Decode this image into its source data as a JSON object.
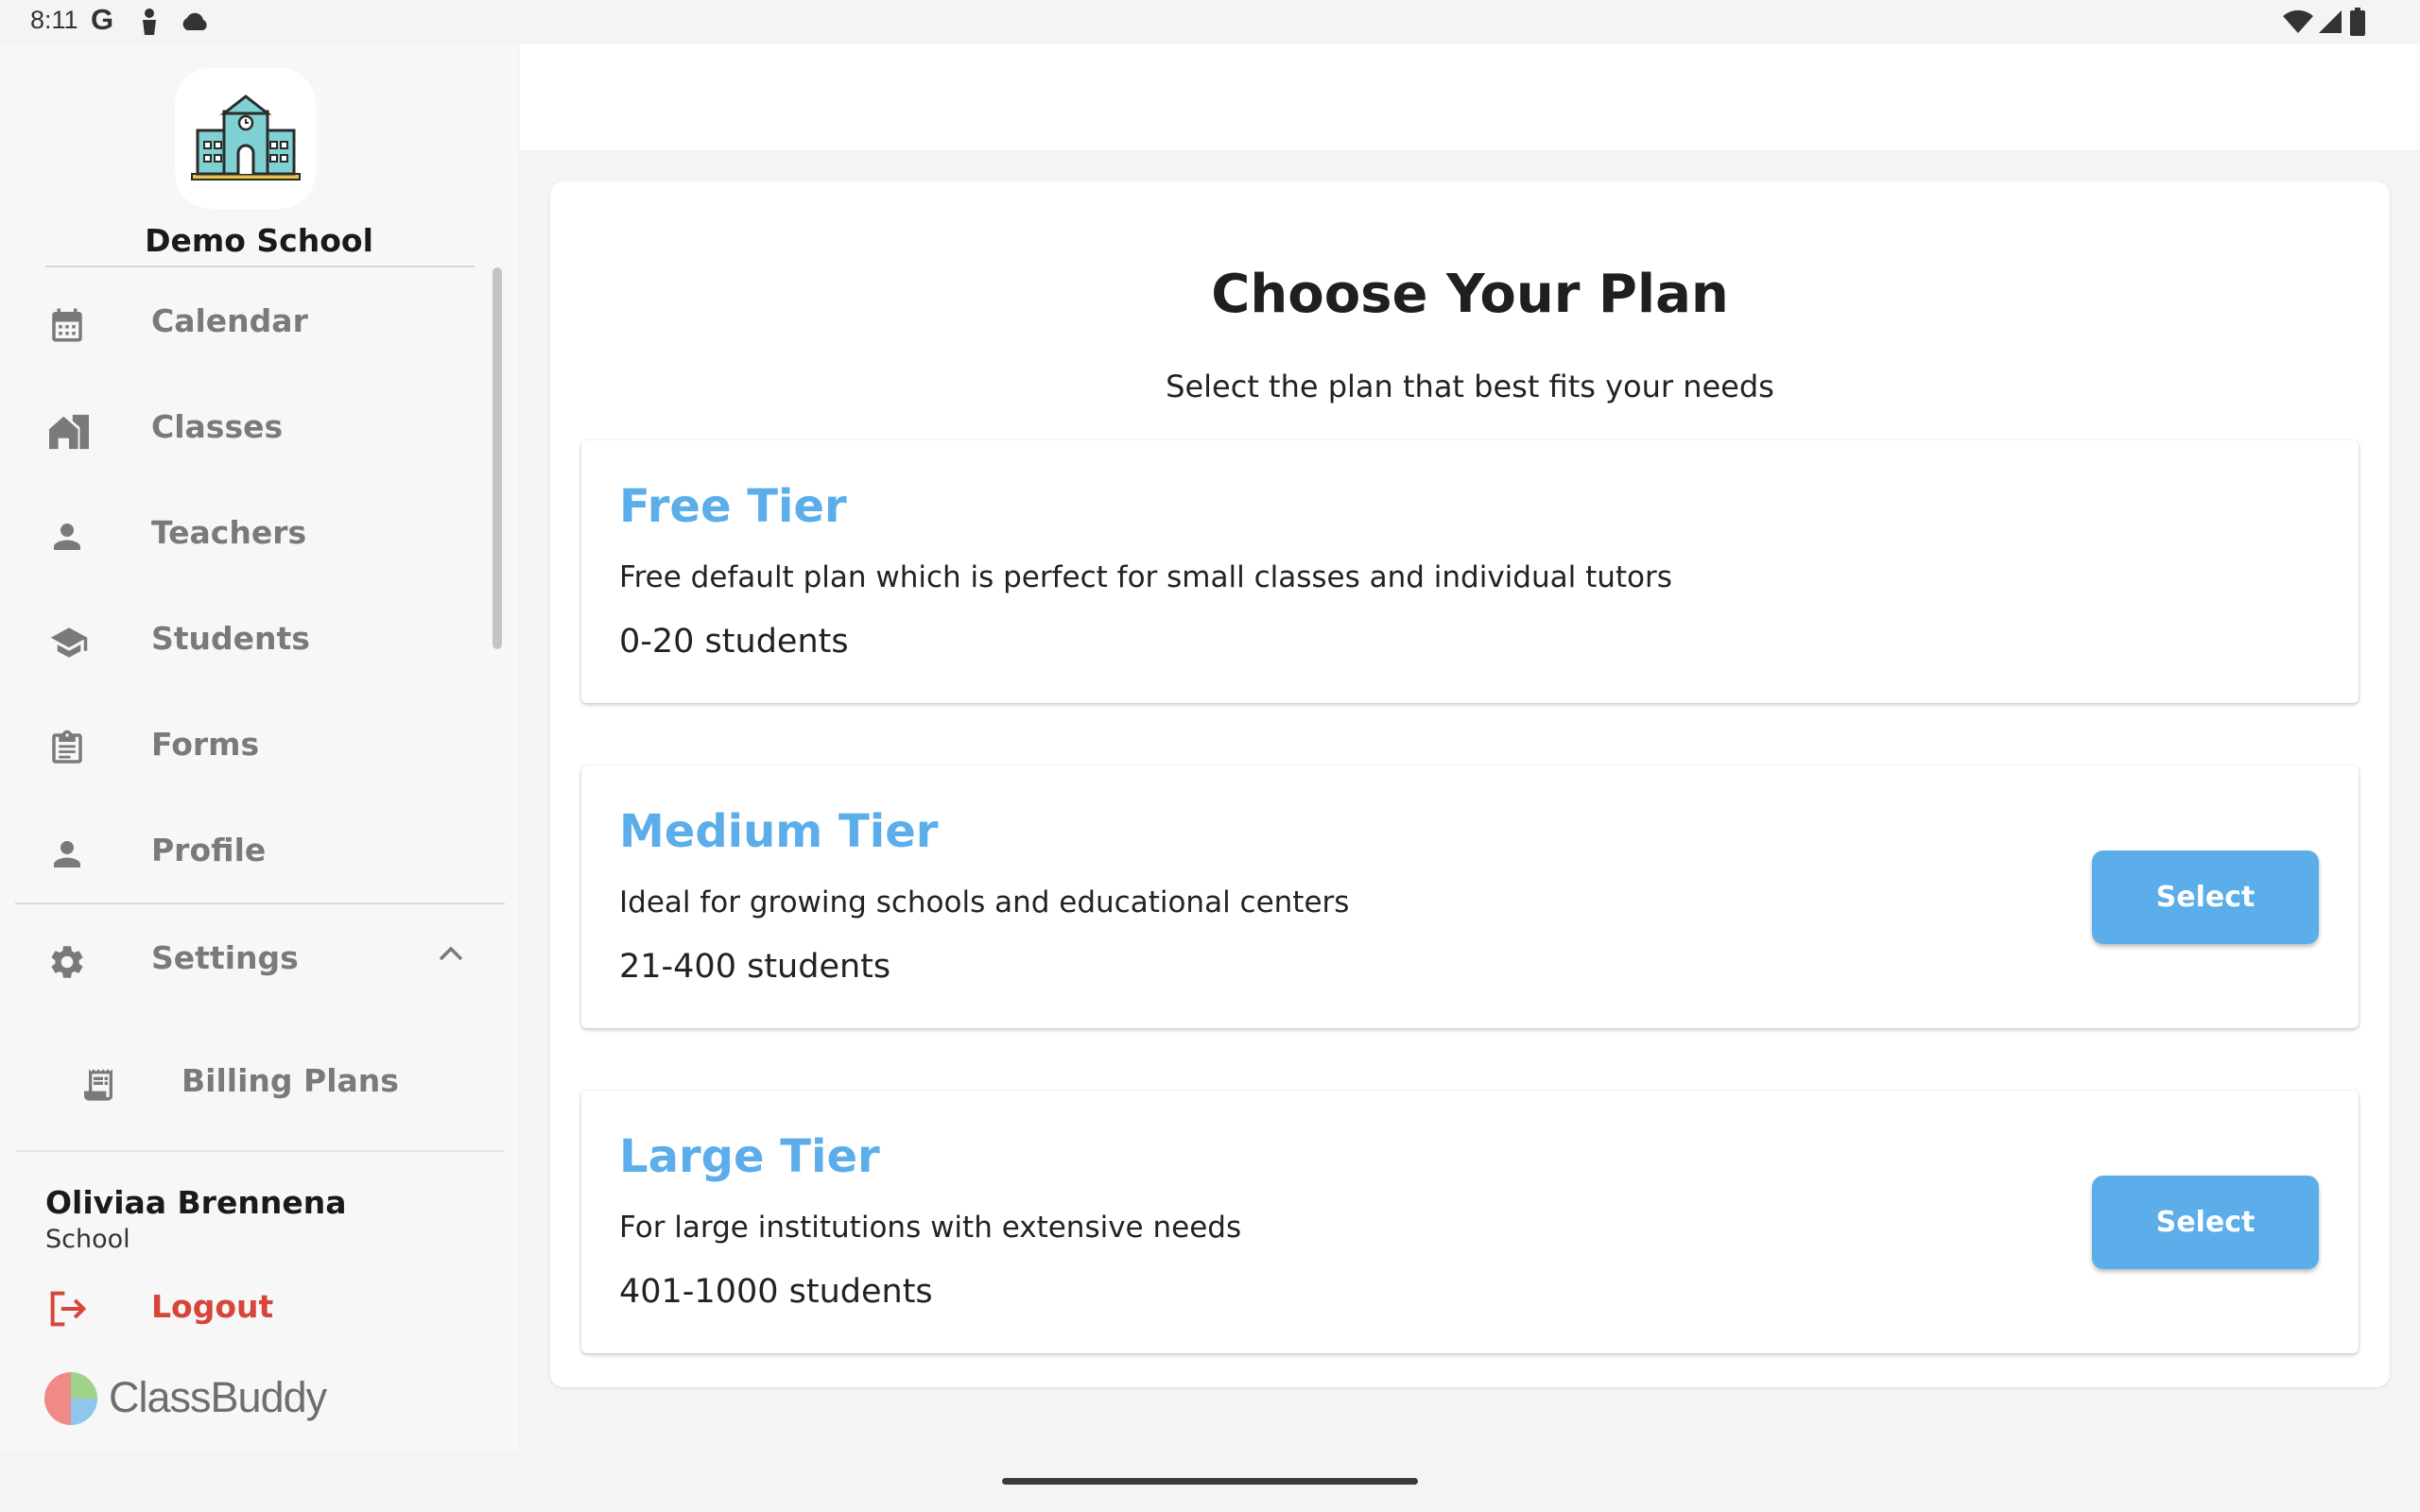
{
  "status": {
    "time": "8:11",
    "google_letter": "G",
    "icons": [
      "google-icon",
      "person-notification-icon",
      "cloud-icon",
      "wifi-icon",
      "signal-icon",
      "battery-icon"
    ]
  },
  "sidebar": {
    "school_name": "Demo School",
    "items": [
      {
        "label": "Calendar",
        "icon": "calendar-icon"
      },
      {
        "label": "Classes",
        "icon": "classes-icon"
      },
      {
        "label": "Teachers",
        "icon": "person-icon"
      },
      {
        "label": "Students",
        "icon": "graduation-cap-icon"
      },
      {
        "label": "Forms",
        "icon": "clipboard-icon"
      },
      {
        "label": "Profile",
        "icon": "person-icon"
      },
      {
        "label": "Settings",
        "icon": "gear-icon",
        "expanded": true
      }
    ],
    "subitems": [
      {
        "label": "Billing Plans",
        "icon": "receipt-icon"
      }
    ],
    "user": {
      "name": "Oliviaa Brennena",
      "role": "School"
    },
    "logout_label": "Logout",
    "brand": "ClassBuddy"
  },
  "main": {
    "title": "Choose Your Plan",
    "subtitle": "Select the plan that best fits your needs",
    "plans": [
      {
        "name": "Free Tier",
        "description": "Free default plan which is perfect for small classes and individual tutors",
        "students": "0-20 students",
        "button": ""
      },
      {
        "name": "Medium Tier",
        "description": "Ideal for growing schools and educational centers",
        "students": "21-400 students",
        "button": "Select"
      },
      {
        "name": "Large Tier",
        "description": "For large institutions with extensive needs",
        "students": "401-1000 students",
        "button": "Select"
      }
    ]
  },
  "colors": {
    "accent": "#5baeea",
    "logout": "#d8453a",
    "nav_text": "#7a7a7a"
  }
}
